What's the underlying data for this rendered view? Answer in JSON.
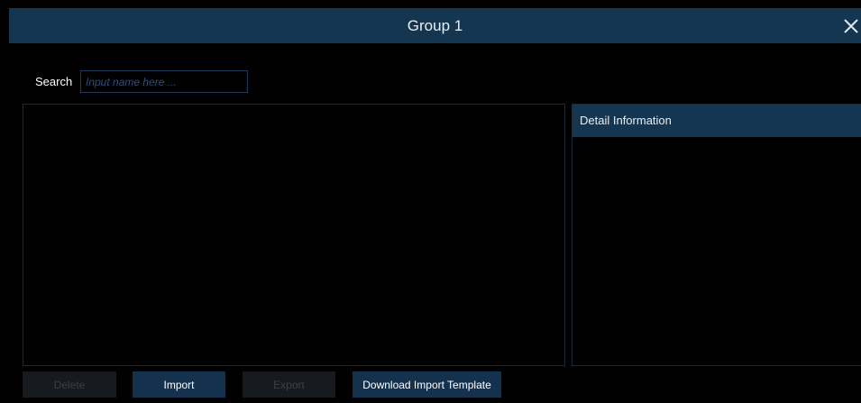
{
  "dialog": {
    "title": "Group 1",
    "close_icon": "close-icon"
  },
  "search": {
    "label": "Search",
    "placeholder": "Input name here ...",
    "value": ""
  },
  "detail_panel": {
    "header": "Detail Information"
  },
  "buttons": {
    "delete": "Delete",
    "import": "Import",
    "export": "Export",
    "download_template": "Download Import Template"
  },
  "colors": {
    "background": "#000000",
    "header_bar": "#143650",
    "active_button": "#14324d",
    "disabled_button": "#171b20",
    "disabled_text": "#3b4046"
  }
}
